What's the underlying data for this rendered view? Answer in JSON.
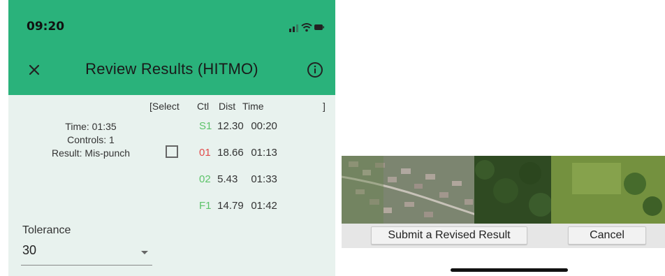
{
  "status_bar": {
    "time": "09:20",
    "icons": [
      "signal-icon",
      "wifi-icon",
      "battery-icon"
    ]
  },
  "app_bar": {
    "title": "Review Results (HITMO)",
    "close_icon": "close-icon",
    "info_icon": "info-icon",
    "background_color": "#2ab27b"
  },
  "table": {
    "headers": {
      "open": "[Select",
      "ctl": "Ctl",
      "dist": "Dist",
      "time": "Time",
      "close": "]"
    },
    "summary": {
      "time": "Time: 01:35",
      "controls": "Controls: 1",
      "result": "Result: Mis-punch"
    },
    "rows": [
      {
        "ctl": "S1",
        "dist": "12.30",
        "time": "00:20",
        "ctl_color": "#5dc36a"
      },
      {
        "ctl": "01",
        "dist": "18.66",
        "time": "01:13",
        "ctl_color": "#e24b4b"
      },
      {
        "ctl": "02",
        "dist": "5.43",
        "time": "01:33",
        "ctl_color": "#5dc36a"
      },
      {
        "ctl": "F1",
        "dist": "14.79",
        "time": "01:42",
        "ctl_color": "#5dc36a"
      }
    ]
  },
  "tolerance": {
    "label": "Tolerance",
    "value": "30"
  },
  "actions": {
    "submit_label": "Submit a Revised Result",
    "cancel_label": "Cancel"
  }
}
